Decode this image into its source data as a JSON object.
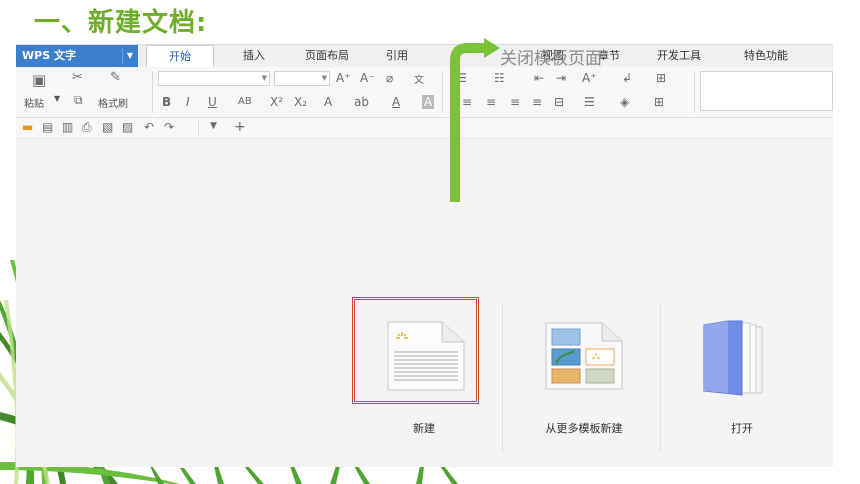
{
  "slide": {
    "title": "一、新建文档:"
  },
  "app": {
    "logo": "WPS 文字",
    "tabs": [
      "开始",
      "插入",
      "页面布局",
      "引用",
      "视图",
      "章节",
      "开发工具",
      "特色功能"
    ],
    "active_tab": "开始"
  },
  "ribbon": {
    "paste": "粘贴",
    "format_painter": "格式刷"
  },
  "annotation": {
    "text": "关闭模板页面"
  },
  "start": {
    "new": "新建",
    "template": "从更多模板新建",
    "open": "打开"
  },
  "colors": {
    "title_green": "#6fae2b",
    "arrow_green": "#7bc23a",
    "wps_blue": "#3b7fcd",
    "highlight_red": "#d6492a"
  }
}
